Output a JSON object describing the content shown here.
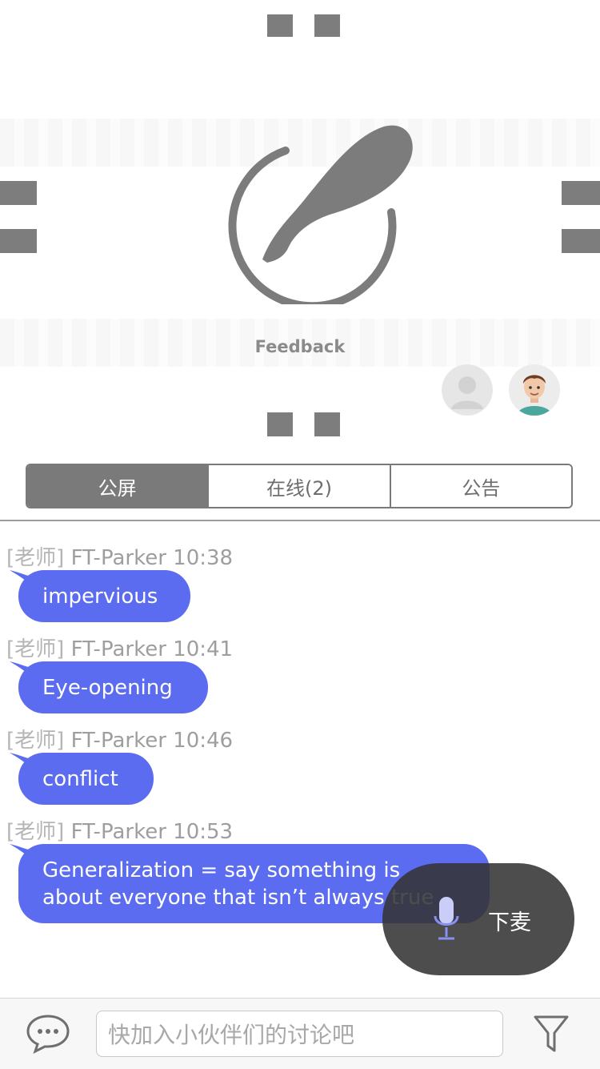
{
  "stage": {
    "logo_caption": "Feedback",
    "logo_icon": "feather-circle-logo-icon"
  },
  "participants": [
    {
      "name": "default-avatar",
      "icon": "user-placeholder-icon"
    },
    {
      "name": "teacher-avatar",
      "icon": "cartoon-man-avatar-icon"
    }
  ],
  "tabs": [
    {
      "label": "公屏",
      "active": true
    },
    {
      "label": "在线(2)",
      "active": false
    },
    {
      "label": "公告",
      "active": false
    }
  ],
  "messages": [
    {
      "role": "[老师]",
      "sender": "FT-Parker",
      "time": "10:38",
      "text": "impervious"
    },
    {
      "role": "[老师]",
      "sender": "FT-Parker",
      "time": "10:41",
      "text": "Eye-opening"
    },
    {
      "role": "[老师]",
      "sender": "FT-Parker",
      "time": "10:46",
      "text": "conflict"
    },
    {
      "role": "[老师]",
      "sender": "FT-Parker",
      "time": "10:53",
      "text": "Generalization = say something is about everyone that isn’t always true"
    }
  ],
  "mic_button": {
    "label": "下麦",
    "icon": "microphone-icon"
  },
  "input": {
    "placeholder": "快加入小伙伴们的讨论吧"
  },
  "icons": {
    "chat": "chat-bubble-icon",
    "filter": "filter-funnel-icon"
  },
  "colors": {
    "bubble": "#5b6cf0",
    "tab_active": "#7a7a7a",
    "mic_pill": "#343434"
  }
}
